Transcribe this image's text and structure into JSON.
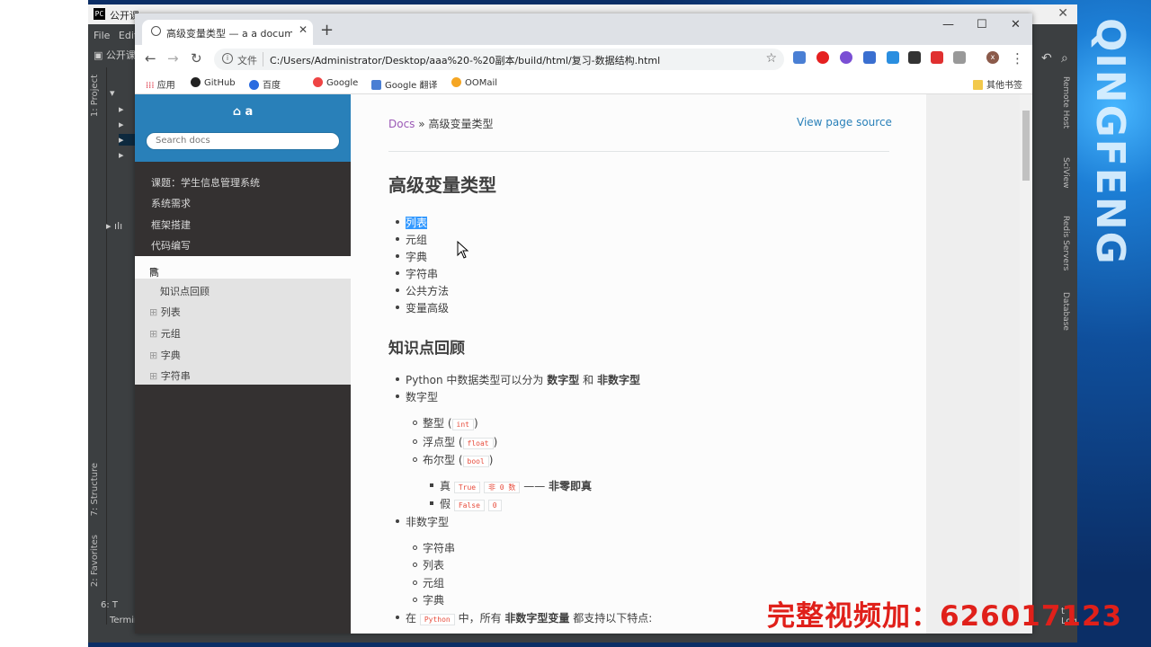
{
  "desktop": {
    "vertical_text": "QINGFENG"
  },
  "ide": {
    "title": "公开课",
    "menu": [
      "File",
      "Edit"
    ],
    "tree_label": "公开课",
    "left_tabs": [
      "1: Project",
      "7: Structure",
      "2: Favorites"
    ],
    "right_tabs": [
      "Remote Host",
      "SciView",
      "Redis Servers",
      "Database"
    ],
    "bottom_items": [
      "6: T",
      "Terminal"
    ],
    "bottom_right": "t Log"
  },
  "browser": {
    "tab_title": "高级变量类型 — a a documentat",
    "address_prefix": "文件",
    "url": "C:/Users/Administrator/Desktop/aaa%20-%20副本/build/html/复习-数据结构.html",
    "profile_initial": "x",
    "bookmarks": [
      "应用",
      "GitHub",
      "百度",
      "Google",
      "Google 翻译",
      "OOMail"
    ],
    "other_bookmarks": "其他书签"
  },
  "sidebar": {
    "project": "a",
    "search_placeholder": "Search docs",
    "items": [
      "课题：学生信息管理系统",
      "系统需求",
      "框架搭建",
      "代码编写"
    ],
    "current": "高级变量类型",
    "sub_items": [
      "知识点回顾",
      "列表",
      "元组",
      "字典",
      "字符串"
    ]
  },
  "content": {
    "breadcrumb_root": "Docs",
    "breadcrumb_sep": "»",
    "breadcrumb_current": "高级变量类型",
    "view_source": "View page source",
    "title": "高级变量类型",
    "toc": [
      "列表",
      "元组",
      "字典",
      "字符串",
      "公共方法",
      "变量高级"
    ],
    "section_title": "知识点回顾",
    "p1": {
      "a": "Python 中数据类型可以分为",
      "b": "数字型",
      "c": "和",
      "d": "非数字型"
    },
    "numeric_label": "数字型",
    "numeric": [
      {
        "label": "整型 (",
        "code": "int",
        "end": ")"
      },
      {
        "label": "浮点型 (",
        "code": "float",
        "end": ")"
      },
      {
        "label": "布尔型 (",
        "code": "bool",
        "end": ")"
      }
    ],
    "bool_true": {
      "label": "真",
      "code1": "True",
      "code2": "非 0 数",
      "dash": "——",
      "bold": "非零即真"
    },
    "bool_false": {
      "label": "假",
      "code1": "False",
      "code2": "0"
    },
    "non_numeric_label": "非数字型",
    "non_numeric": [
      "字符串",
      "列表",
      "元组",
      "字典"
    ],
    "last": {
      "a": "在",
      "code": "Python",
      "b": "中，所有",
      "bold": "非数字型变量",
      "c": "都支持以下特点:"
    }
  },
  "watermark": "完整视频加：626017123"
}
